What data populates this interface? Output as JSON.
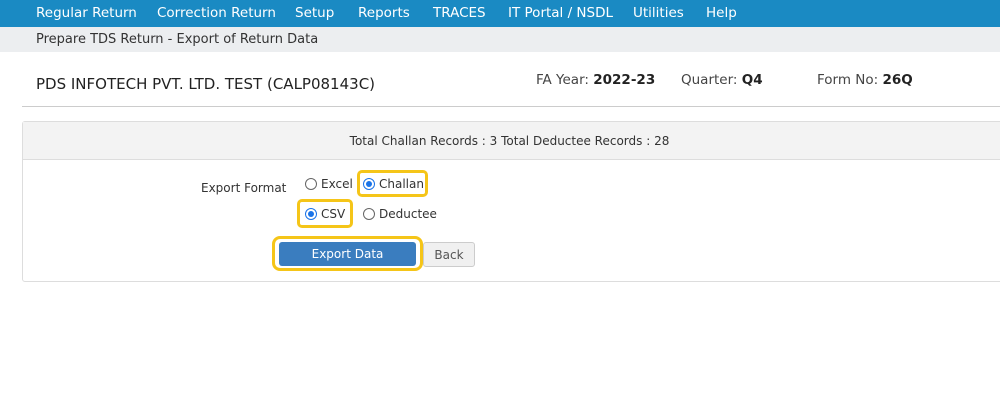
{
  "nav": [
    "Regular Return",
    "Correction Return",
    "Setup",
    "Reports",
    "TRACES",
    "IT Portal / NSDL",
    "Utilities",
    "Help"
  ],
  "breadcrumb": "Prepare TDS Return - Export of Return Data",
  "company": "PDS INFOTECH PVT. LTD. TEST (CALP08143C)",
  "meta": {
    "fa_label": "FA Year:",
    "fa_value": "2022-23",
    "q_label": "Quarter:",
    "q_value": "Q4",
    "form_label": "Form No:",
    "form_value": "26Q"
  },
  "summary": "Total Challan Records : 3 Total Deductee Records : 28",
  "export_format": {
    "label": "Export Format",
    "options": {
      "excel": "Excel",
      "challan": "Challan",
      "csv": "CSV",
      "deductee": "Deductee"
    },
    "selected": [
      "Challan",
      "CSV"
    ]
  },
  "buttons": {
    "export": "Export Data",
    "back": "Back"
  },
  "colors": {
    "nav": "#1a8ac3",
    "primary": "#3a7dbf",
    "highlight": "#f5c518"
  }
}
